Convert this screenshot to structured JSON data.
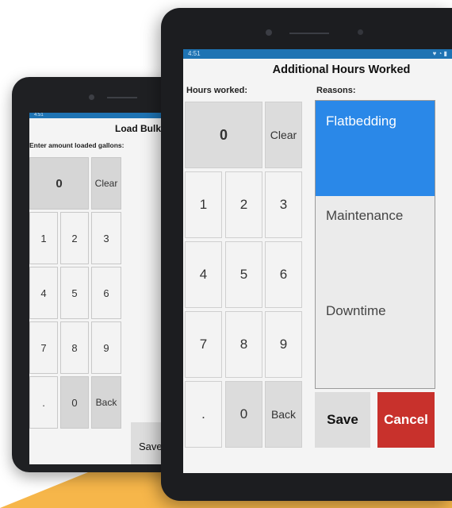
{
  "back_device": {
    "status_time": "4:51",
    "title": "Load Bulk Fuel",
    "prompt": "Enter amount loaded gallons:",
    "display_value": "0",
    "clear_label": "Clear",
    "keys": [
      "1",
      "2",
      "3",
      "4",
      "5",
      "6",
      "7",
      "8",
      "9",
      ".",
      "0",
      "Back"
    ],
    "save_label": "Save"
  },
  "front_device": {
    "status_time": "4:51",
    "status_icons": "♥ ◔ ▮",
    "title": "Additional Hours Worked",
    "hours_label": "Hours worked:",
    "reasons_label": "Reasons:",
    "display_value": "0",
    "clear_label": "Clear",
    "keys": [
      "1",
      "2",
      "3",
      "4",
      "5",
      "6",
      "7",
      "8",
      "9",
      ".",
      "0",
      "Back"
    ],
    "reasons": [
      "Flatbedding",
      "Maintenance",
      "Downtime"
    ],
    "selected_reason": "Flatbedding",
    "save_label": "Save",
    "cancel_label": "Cancel"
  },
  "colors": {
    "status_bar": "#1e73b3",
    "selected_reason": "#2a88e8",
    "cancel_button": "#c8312c",
    "accent_shape": "#f6b64a"
  }
}
